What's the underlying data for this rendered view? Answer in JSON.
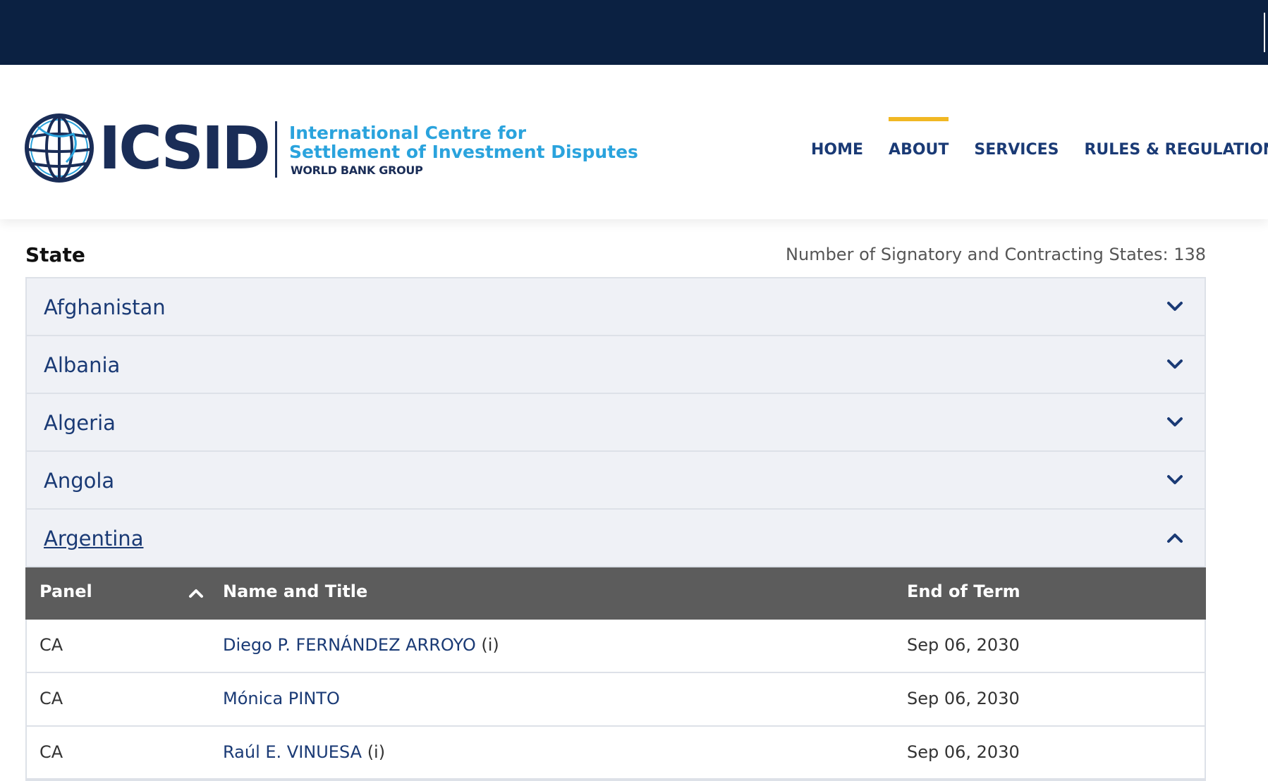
{
  "brand": {
    "acronym": "ICSID",
    "line1": "International Centre for",
    "line2": "Settlement of Investment Disputes",
    "line3": "WORLD BANK GROUP",
    "colors": {
      "navy": "#0b2142",
      "dark_blue": "#1a2d57",
      "light_blue": "#2aa3dd",
      "accent": "#f1b823"
    }
  },
  "nav": {
    "items": [
      {
        "label": "HOME",
        "active": false
      },
      {
        "label": "ABOUT",
        "active": true
      },
      {
        "label": "SERVICES",
        "active": false
      },
      {
        "label": "RULES & REGULATIONS",
        "active": false
      }
    ]
  },
  "states": {
    "heading": "State",
    "count_text": "Number of Signatory and Contracting States: 138",
    "items": [
      {
        "name": "Afghanistan",
        "expanded": false,
        "icon": "chevron-down-icon"
      },
      {
        "name": "Albania",
        "expanded": false,
        "icon": "chevron-down-icon"
      },
      {
        "name": "Algeria",
        "expanded": false,
        "icon": "chevron-down-icon"
      },
      {
        "name": "Angola",
        "expanded": false,
        "icon": "chevron-down-icon"
      },
      {
        "name": "Argentina",
        "expanded": true,
        "icon": "chevron-up-icon"
      }
    ]
  },
  "panel_table": {
    "columns": {
      "panel": "Panel",
      "name": "Name and Title",
      "end": "End of Term"
    },
    "sort_icon": "chevron-up-icon",
    "rows": [
      {
        "panel": "CA",
        "name": "Diego P. FERNÁNDEZ ARROYO",
        "suffix": " (i)",
        "end": "Sep 06, 2030"
      },
      {
        "panel": "CA",
        "name": "Mónica PINTO",
        "suffix": "",
        "end": "Sep 06, 2030"
      },
      {
        "panel": "CA",
        "name": "Raúl E. VINUESA",
        "suffix": " (i)",
        "end": "Sep 06, 2030"
      }
    ]
  }
}
